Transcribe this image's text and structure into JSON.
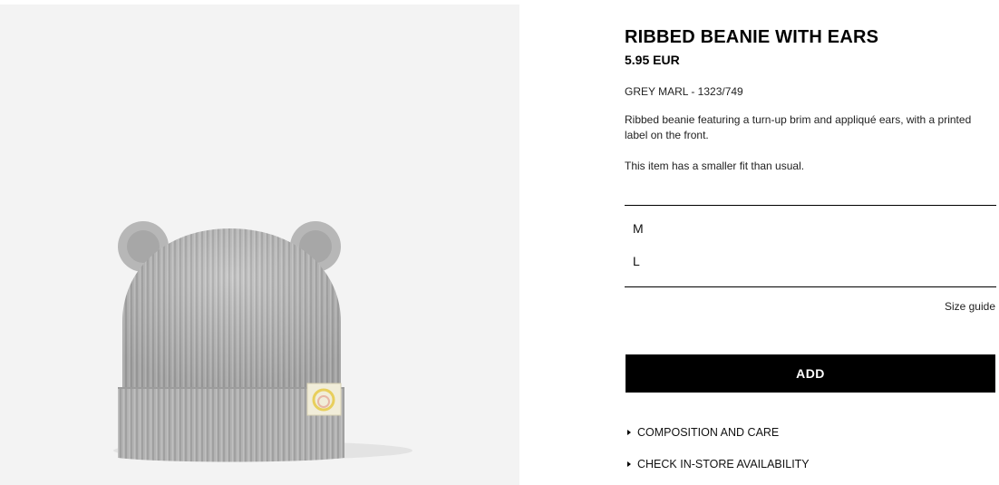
{
  "product": {
    "title": "RIBBED BEANIE WITH EARS",
    "price": "5.95 EUR",
    "color_ref": "GREY MARL - 1323/749",
    "description": "Ribbed beanie featuring a turn-up brim and appliqué ears, with a printed label on the front.",
    "fit_note": "This item has a smaller fit than usual."
  },
  "sizes": [
    "M",
    "L"
  ],
  "size_guide_label": "Size guide",
  "add_button_label": "ADD",
  "accordion": [
    {
      "label": "COMPOSITION AND CARE",
      "icon": "caret-right-icon"
    },
    {
      "label": "CHECK IN-STORE AVAILABILITY",
      "icon": "caret-right-icon"
    }
  ],
  "colors": {
    "background_panel": "#f3f3f3",
    "product_grey": "#b9b9b9",
    "button_bg": "#000000",
    "label_yellow": "#e8cf5c"
  }
}
